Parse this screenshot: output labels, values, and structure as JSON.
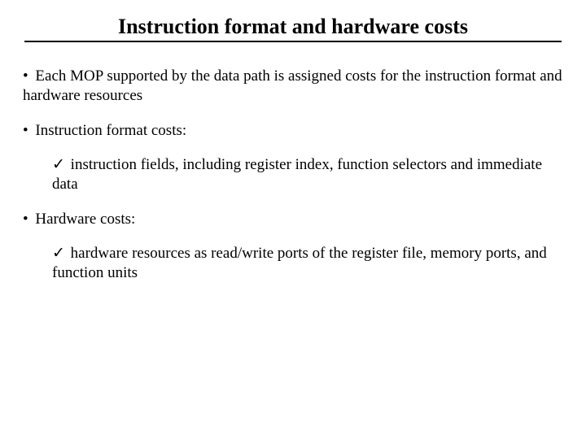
{
  "title": "Instruction format and hardware costs",
  "bullets": {
    "b1": "Each MOP supported by the data path is assigned costs for the instruction format and hardware resources",
    "b2": "Instruction format costs:",
    "b2_1": "instruction fields, including register index, function selectors and immediate data",
    "b3": "Hardware costs:",
    "b3_1": "hardware resources as read/write ports of the register file, memory ports, and function units"
  },
  "glyphs": {
    "dot": "•",
    "check": "✓"
  }
}
